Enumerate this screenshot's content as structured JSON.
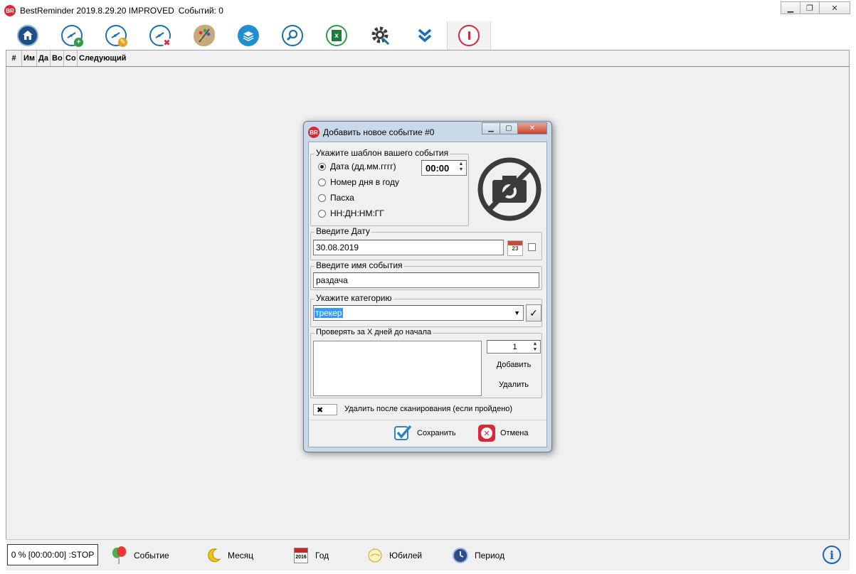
{
  "window": {
    "title": "BestReminder 2019.8.29.20 IMPROVED",
    "events_count": "Событий: 0",
    "logo_text": "BR"
  },
  "toolbar": {
    "buttons": [
      {
        "icon": "home-icon"
      },
      {
        "icon": "add-event-icon"
      },
      {
        "icon": "edit-event-icon"
      },
      {
        "icon": "delete-event-icon"
      },
      {
        "icon": "palette-icon"
      },
      {
        "icon": "layers-icon"
      },
      {
        "icon": "search-icon"
      },
      {
        "icon": "excel-icon"
      },
      {
        "icon": "settings-icon"
      },
      {
        "icon": "double-chevron-down-icon"
      },
      {
        "icon": "power-icon"
      }
    ]
  },
  "grid": {
    "columns": [
      "#",
      "Им",
      "Да",
      "Во",
      "Со",
      "Следующий"
    ]
  },
  "statusbar": {
    "progress": "0 % [00:00:00] :STOP",
    "items": [
      {
        "label": "Событие",
        "icon": "balloon-icon"
      },
      {
        "label": "Месяц",
        "icon": "moon-icon"
      },
      {
        "label": "Год",
        "icon": "calendar-year-icon"
      },
      {
        "label": "Юбилей",
        "icon": "cake-icon"
      },
      {
        "label": "Период",
        "icon": "clock-icon"
      }
    ],
    "calendar_year": "2016"
  },
  "dialog": {
    "title": "Добавить новое событие #0",
    "template_group": {
      "legend": "Укажите шаблон вашего события",
      "options": [
        "Дата (дд.мм.гггг)",
        "Номер дня в году",
        "Пасха",
        "НН:ДН:НМ:ГГ"
      ],
      "selected_index": 0,
      "time_value": "00:00"
    },
    "date_group": {
      "legend": "Введите Дату",
      "value": "30.08.2019",
      "calendar_day": "23"
    },
    "name_group": {
      "legend": "Введите  имя события",
      "value": "раздача"
    },
    "category_group": {
      "legend": "Укажите категорию",
      "value": "трекер",
      "confirm_glyph": "✓"
    },
    "check_group": {
      "legend": "Проверять за X дней до начала",
      "days_value": "1",
      "add_label": "Добавить",
      "remove_label": "Удалить"
    },
    "delete_after_scan": {
      "label": "Удалить после сканирования (если пройдено)",
      "checked": true
    },
    "save_label": "Сохранить",
    "cancel_label": "Отмена"
  },
  "colors": {
    "accent_blue": "#1a6fb0",
    "brand_red": "#d8283a",
    "selection": "#3399ff"
  }
}
